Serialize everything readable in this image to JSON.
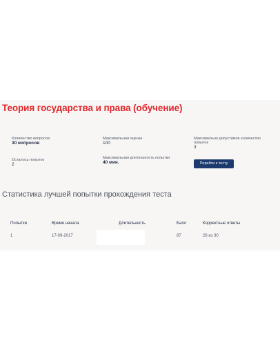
{
  "test": {
    "title": "Теория государства и права (обучение)"
  },
  "stats": {
    "questions_label": "Количество вопросов",
    "questions_value": "30 вопросов",
    "max_score_label": "Максимальная оценка",
    "max_score_value": "100",
    "max_attempts_label": "Максимально допустимое количество попыток",
    "max_attempts_value": "3",
    "remaining_label": "Осталось попыток",
    "remaining_value": "2",
    "max_duration_label": "Максимальная длительность попытки",
    "max_duration_value": "40 мин."
  },
  "actions": {
    "go_to_test_label": "Перейти к тесту"
  },
  "best_attempt": {
    "heading": "Статистика лучшей попытки прохождения теста",
    "columns": [
      "Попытки",
      "Время начала",
      "Длительность",
      "Балл",
      "Корректные ответы"
    ],
    "rows": [
      [
        "1",
        "17-09-2017",
        "",
        "87",
        "26 из 30"
      ]
    ]
  },
  "colors": {
    "title_red": "#e0262b",
    "button_navy": "#1c3a6e",
    "panel_bg": "#f8f6f5"
  }
}
